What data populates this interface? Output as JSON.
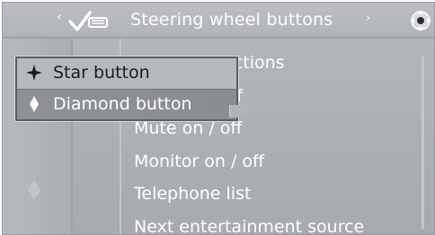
{
  "header": {
    "title": "Steering wheel buttons",
    "left_arrow": "‹",
    "right_arrow": "›",
    "icons": {
      "check": "checkmark-car-icon",
      "controller": "controller-direction-icon"
    }
  },
  "popup": {
    "options": [
      {
        "label": "Star button",
        "icon": "star-icon",
        "selected": false
      },
      {
        "label": "Diamond button",
        "icon": "diamond-icon",
        "selected": true
      }
    ]
  },
  "functions": [
    "Navigation voice instructions",
    "Repeat navigation on / off",
    "Mute on / off",
    "Monitor on / off",
    "Telephone list",
    "Next entertainment source"
  ],
  "visible_functions": [
    "voice instructions",
    "ation on / off",
    "Mute on / off",
    "Monitor on / off",
    "Telephone list",
    "Next entertainment source"
  ],
  "left_icon": "diamond-icon",
  "colors": {
    "text": "#ffffff",
    "popup_selected": "#8c8f94",
    "popup_text_dark": "#1b1c1f"
  }
}
